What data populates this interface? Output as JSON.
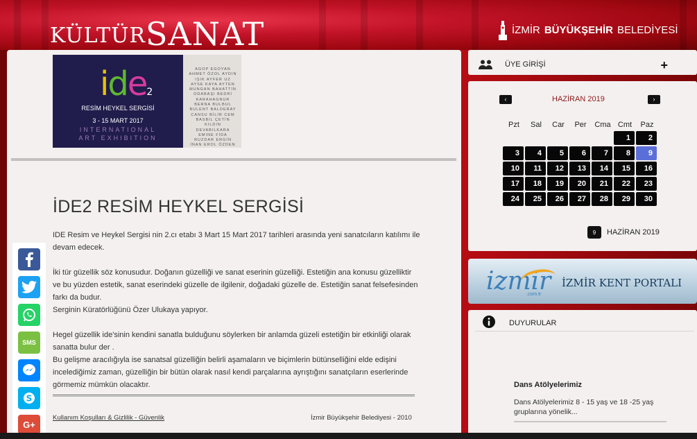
{
  "header": {
    "logo_kultur": "KÜLTÜR",
    "logo_sanat": "SANAT",
    "belediye_prefix": "İZMİR",
    "belediye_bold": "BÜYÜKŞEHİR",
    "belediye_suffix": "BELEDİYESİ"
  },
  "banner": {
    "logo_i": "i",
    "logo_d": "d",
    "logo_e": "e",
    "logo_num": "2",
    "line1": "RESİM HEYKEL SERGİSİ",
    "line2": "3 - 15 MART 2017",
    "line3": "INTERNATIONAL",
    "line4": "ART EXHIBITION",
    "artists": "AGOP EGOYAN AHMET ÖZOL AYDIN IŞIK AYFER UZ AYSE KAYA AYTEN MUNGAN BAHATTİN ODABAŞI BEDRİ KARAHAGNUR BERNA BULBUL BULENT BALDERAY CANSU BİLİR CEM BASBIL ÇETİN KILDIN DEVABILKARA EMINE FİDA RUZDAR ERGİN İNAN EROL ÖZDEN EROL KINALI ERTUĞRUL ATEŞ EVSEN ALGI ÇELİK"
  },
  "article": {
    "title": "İDE2 RESİM HEYKEL SERGİSİ",
    "p1": " IDE Resim ve Heykel Sergisi nin 2.cı etabı 3 Mart 15 Mart 2017 tarihleri arasında yeni sanatcıların katılımı ile devam edecek.",
    "p2": "İki tür güzellik söz konusudur. Doğanın güzelliği ve sanat eserinin güzelliği. Estetiğin ana konusu güzelliktir ve bu yüzden estetik, sanat eserindeki güzelle de ilgilenir, doğadaki güzelle de. Estetiğin sanat felsefesinden farkı da budur.",
    "p3": "Serginin Küratörlüğünü Özer Ulukaya yapıyor.",
    "p4": "Hegel güzellik ide'sinin kendini sanatla bulduğunu söylerken bir anlamda güzeli estetiğin bir etkinliği olarak sanatta bulur der .",
    "p5": "Bu gelişme aracılığıyla ise sanatsal güzelliğin belirli aşamaların ve biçimlerin bütünselliğini elde edişini incelediğimiz zaman, güzelliğin bir bütün olarak nasıl kendi parçalarına ayrıştığını sanatçıların eserlerinde görmemiz mümkün olacaktır."
  },
  "footer": {
    "links": "Kullanım Koşulları & Gizlilik - Güvenlik",
    "copyright": "İzmir Büyükşehir Belediyesi - 2010"
  },
  "share": {
    "icons": [
      "facebook-icon",
      "twitter-icon",
      "whatsapp-icon",
      "sms-icon",
      "messenger-icon",
      "skype-icon",
      "google-plus-icon"
    ],
    "sms_label": "SMS",
    "gplus_label": "G+"
  },
  "sidebar": {
    "login_label": "ÜYE GİRİŞİ",
    "login_toggle": "+",
    "calendar": {
      "month": "HAZİRAN 2019",
      "prev": "‹",
      "next": "›",
      "days_of_week": [
        "Pzt",
        "Sal",
        "Car",
        "Per",
        "Cma",
        "Cmt",
        "Paz"
      ],
      "today": "9",
      "footer_label": "HAZİRAN 2019",
      "footer_icon_num": "9"
    },
    "portal_logo": "izmir",
    "portal_sub": ".com.tr",
    "portal_label": "İZMİR KENT PORTALI",
    "duyurular_label": "DUYURULAR",
    "duyuru_title": "Dans Atölyelerimiz",
    "duyuru_text": "Dans Atölyelerimiz 8 - 15 yaş ve 18 -25 yaş gruplarına yönelik..."
  },
  "colors": {
    "accent_red": "#c8111a",
    "today_blue": "#5b6fd8",
    "month_red": "#8b1a1a"
  }
}
